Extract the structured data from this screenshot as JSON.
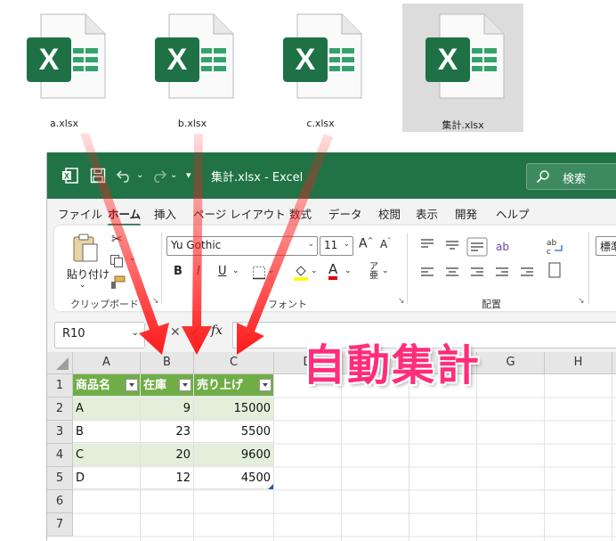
{
  "desktop_files": [
    {
      "name": "a.xlsx",
      "selected": false
    },
    {
      "name": "b.xlsx",
      "selected": false
    },
    {
      "name": "c.xlsx",
      "selected": false
    },
    {
      "name": "集計.xlsx",
      "selected": true
    }
  ],
  "file_icon": {
    "letter": "X"
  },
  "window": {
    "title": "集計.xlsx  -  Excel",
    "search_label": "検索",
    "accent_color": "#217346"
  },
  "tabs": [
    "ファイル",
    "ホーム",
    "挿入",
    "ページ レイアウト",
    "数式",
    "データ",
    "校閲",
    "表示",
    "開発",
    "ヘルプ"
  ],
  "active_tab": "ホーム",
  "ribbon": {
    "clipboard": {
      "paste": "貼り付け",
      "label": "クリップボード"
    },
    "font": {
      "name": "Yu Gothic",
      "size": "11",
      "bold": "B",
      "italic": "I",
      "underline": "U",
      "grow": "A",
      "shrink": "A",
      "label": "フォント"
    },
    "align": {
      "label": "配置"
    },
    "number": {
      "format": "標準"
    }
  },
  "formula_bar": {
    "name_box": "R10",
    "fx": "fx"
  },
  "columns": [
    "A",
    "B",
    "C",
    "D",
    "E",
    "F",
    "G",
    "H"
  ],
  "rows": [
    "1",
    "2",
    "3",
    "4",
    "5",
    "6",
    "7"
  ],
  "table": {
    "headers": [
      "商品名",
      "在庫",
      "売り上げ"
    ],
    "data": [
      [
        "A",
        "9",
        "15000"
      ],
      [
        "B",
        "23",
        "5500"
      ],
      [
        "C",
        "20",
        "9600"
      ],
      [
        "D",
        "12",
        "4500"
      ]
    ],
    "header_color": "#70ad47",
    "band_color": "#e2efda"
  },
  "overlay": {
    "caption": "自動集計",
    "caption_color": "#ff2d7a",
    "arrow_color": "#ff1a1a"
  }
}
